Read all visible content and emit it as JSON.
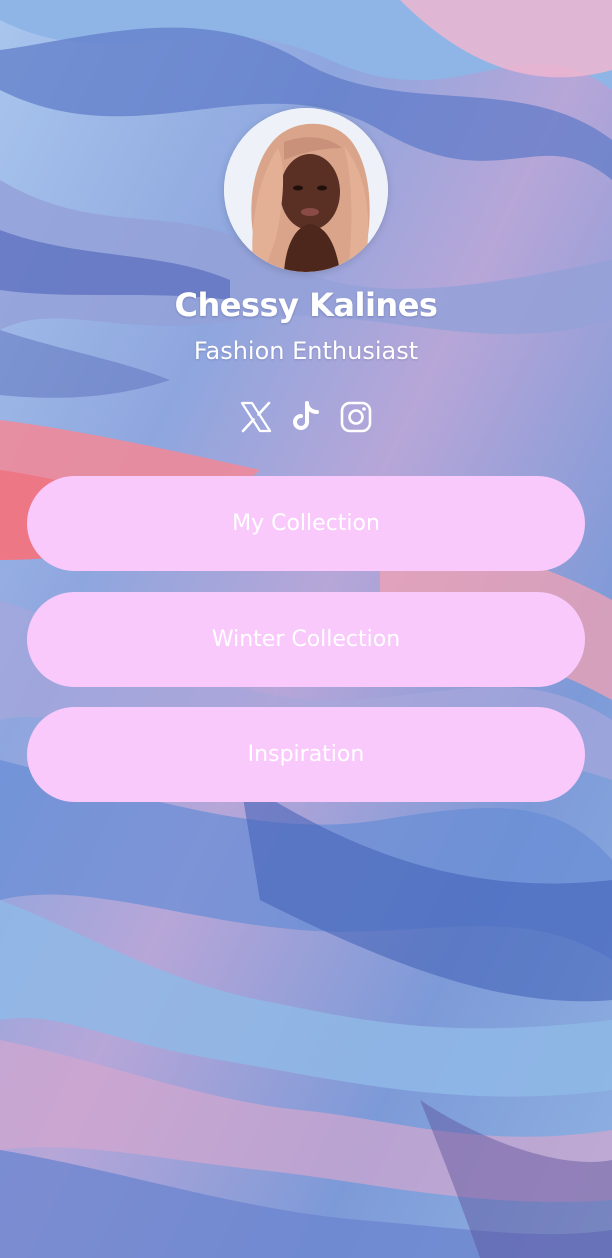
{
  "profile": {
    "name": "Chessy Kalines",
    "tagline": "Fashion Enthusiast",
    "avatar_icon": "profile-photo"
  },
  "socials": [
    {
      "icon": "x-icon",
      "platform": "X"
    },
    {
      "icon": "tiktok-icon",
      "platform": "TikTok"
    },
    {
      "icon": "instagram-icon",
      "platform": "Instagram"
    }
  ],
  "links": [
    {
      "label": "My Collection"
    },
    {
      "label": "Winter Collection"
    },
    {
      "label": "Inspiration"
    }
  ],
  "colors": {
    "button_bg": "#f9c9fc",
    "button_text": "#ffffff",
    "text": "#ffffff"
  }
}
